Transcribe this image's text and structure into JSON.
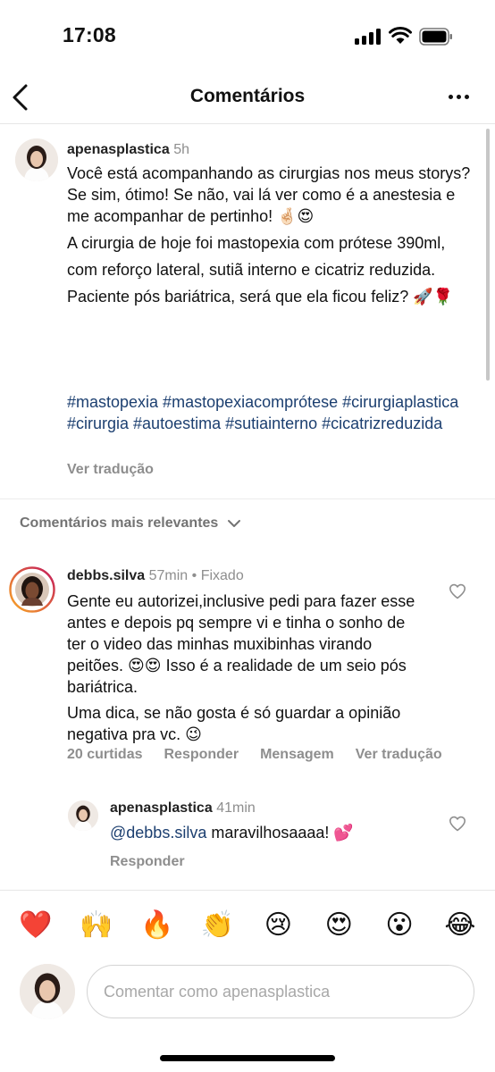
{
  "status_bar": {
    "time": "17:08"
  },
  "header": {
    "title": "Comentários"
  },
  "caption": {
    "username": "apenasplastica",
    "time": "5h",
    "paragraphs": [
      "Você está acompanhando as cirurgias nos meus storys? Se sim, ótimo! Se não, vai lá ver como é a anestesia e me acompanhar de pertinho! 🤞🏻😍",
      "A cirurgia de hoje foi mastopexia com prótese 390ml,",
      "com reforço lateral, sutiã interno e cicatriz reduzida.",
      "Paciente pós bariátrica, será que ela ficou feliz? 🚀🌹"
    ],
    "hashtags": "#mastopexia #mastopexiacomprótese #cirurgiaplastica #cirurgia #autoestima #sutiainterno #cicatrizreduzida",
    "see_translation": "Ver tradução"
  },
  "filter": {
    "label": "Comentários mais relevantes"
  },
  "comments": [
    {
      "username": "debbs.silva",
      "time": "57min",
      "separator": "•",
      "pinned": "Fixado",
      "paragraphs": [
        "Gente eu autorizei,inclusive pedi para fazer esse antes e depois pq sempre vi e tinha o sonho de ter o video das minhas muxibinhas virando peitões. 😍😍 Isso é a realidade de um seio pós bariátrica.",
        "Uma dica, se não gosta é só guardar a opinião negativa pra vc. 😉"
      ],
      "likes": "20 curtidas",
      "reply": "Responder",
      "message": "Mensagem",
      "translate": "Ver tradução"
    }
  ],
  "reply": {
    "username": "apenasplastica",
    "time": "41min",
    "mention": "@debbs.silva",
    "text": " maravilhosaaaa! 💕",
    "reply_label": "Responder"
  },
  "emoji_bar": [
    "❤️",
    "🙌",
    "🔥",
    "👏",
    "😢",
    "😍",
    "😮",
    "😂"
  ],
  "composer": {
    "placeholder": "Comentar como apenasplastica"
  },
  "colors": {
    "link": "#1c3f70",
    "muted": "#8e8e8e",
    "story_ring_start": "#f9a825",
    "story_ring_end": "#c2185b"
  },
  "icons": [
    "back-chevron-icon",
    "more-dots-icon",
    "chevron-down-icon",
    "heart-icon",
    "signal-icon",
    "wifi-icon",
    "battery-icon"
  ]
}
